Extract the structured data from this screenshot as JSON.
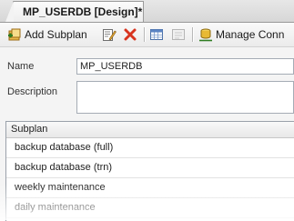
{
  "document_tab": {
    "title": "MP_USERDB [Design]*"
  },
  "toolbar": {
    "add_subplan_label": "Add Subplan",
    "manage_connections_label": "Manage Conn",
    "icons": [
      "add-subplan-icon",
      "edit-properties-icon",
      "delete-icon",
      "schedule-icon",
      "disabled-icon",
      "manage-connections-icon"
    ]
  },
  "properties": {
    "name_label": "Name",
    "name_value": "MP_USERDB",
    "description_label": "Description",
    "description_value": ""
  },
  "subplans": {
    "header": "Subplan",
    "rows": [
      "backup database (full)",
      "backup database (trn)",
      "weekly maintenance",
      "daily maintenance"
    ]
  },
  "colors": {
    "delete_icon": "#d8341f",
    "grid_border": "#9aa1aa"
  }
}
